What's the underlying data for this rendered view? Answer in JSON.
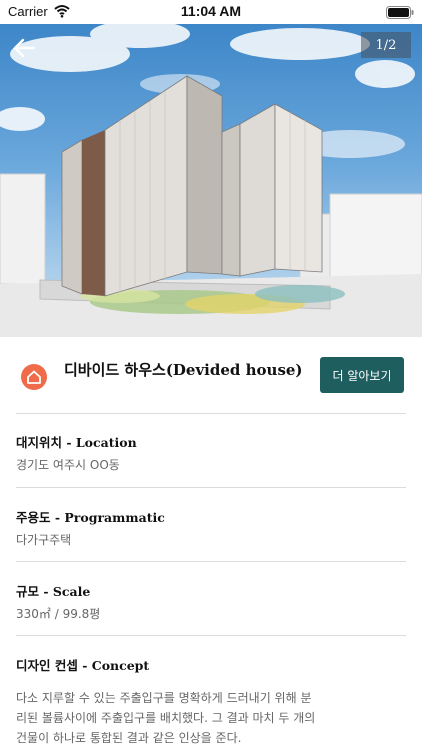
{
  "status_bar": {
    "carrier": "Carrier",
    "time": "11:04 AM"
  },
  "hero": {
    "page_indicator": "1/2",
    "back_icon": "arrow-left-icon"
  },
  "project": {
    "icon": "house-icon",
    "icon_color": "#ef6b4a",
    "title": "디바이드 하우스(Devided house)",
    "more_button_label": "더 알아보기",
    "more_button_color": "#1f5e5e"
  },
  "sections": [
    {
      "label": "대지위치 - Location",
      "value": "경기도 여주시 OO동"
    },
    {
      "label": "주용도 - Programmatic",
      "value": "다가구주택"
    },
    {
      "label": "규모 - Scale",
      "value": "330㎡ / 99.8평"
    },
    {
      "label": "디자인 컨셉 - Concept",
      "value": "다소 지루할 수 있는 주출입구를 명확하게 드러내기 위해 분리된 볼륨사이에 주출입구를 배치했다. 그 결과 마치 두 개의 건물이 하나로 통합된 결과 같은 인상을 준다."
    }
  ]
}
